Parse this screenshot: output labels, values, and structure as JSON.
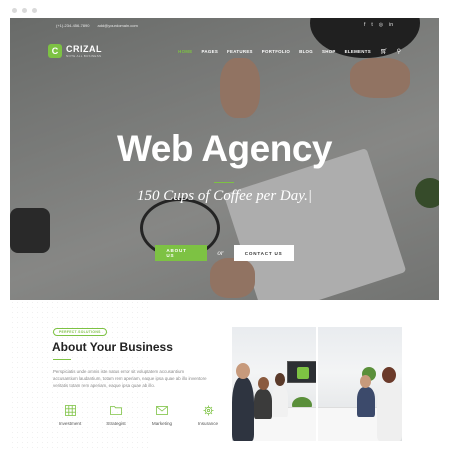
{
  "topbar": {
    "phone": "(+1)-234-456-7890",
    "email": "add@yourdomain.com",
    "social_icons": [
      "facebook-icon",
      "twitter-icon",
      "instagram-icon",
      "linkedin-icon"
    ]
  },
  "logo": {
    "mark": "C",
    "name": "CRIZAL",
    "tagline": "NOTE ALL BUSINESS"
  },
  "nav": {
    "items": [
      {
        "label": "HOME",
        "active": true
      },
      {
        "label": "PAGES"
      },
      {
        "label": "FEATURES"
      },
      {
        "label": "PORTFOLIO"
      },
      {
        "label": "BLOG"
      },
      {
        "label": "SHOP"
      },
      {
        "label": "ELEMENTS"
      }
    ],
    "cart_count": "0"
  },
  "hero": {
    "title": "Web Agency",
    "subtitle": "150 Cups of Coffee per Day.|",
    "primary_button": "ABOUT US",
    "or_text": "or",
    "secondary_button": "CONTACT US"
  },
  "about": {
    "badge": "PERFECT SOLUTIONS",
    "title": "About Your Business",
    "text": "Perspiciatis unde omnis iste natus error sit voluptatem accusantium accusantium laudantium, totam rem aperiam, eaque ipsa quae ab illo inventore veritatis totam rem aperiam, eaque ipsa quae ab illo.",
    "features": [
      {
        "label": "Investment",
        "icon": "grid-icon"
      },
      {
        "label": "Strategist",
        "icon": "folder-icon"
      },
      {
        "label": "Marketing",
        "icon": "mail-icon"
      },
      {
        "label": "Insurance",
        "icon": "gear-icon"
      }
    ]
  },
  "colors": {
    "accent": "#7dc243",
    "text_dark": "#222222",
    "text_muted": "#888888"
  }
}
